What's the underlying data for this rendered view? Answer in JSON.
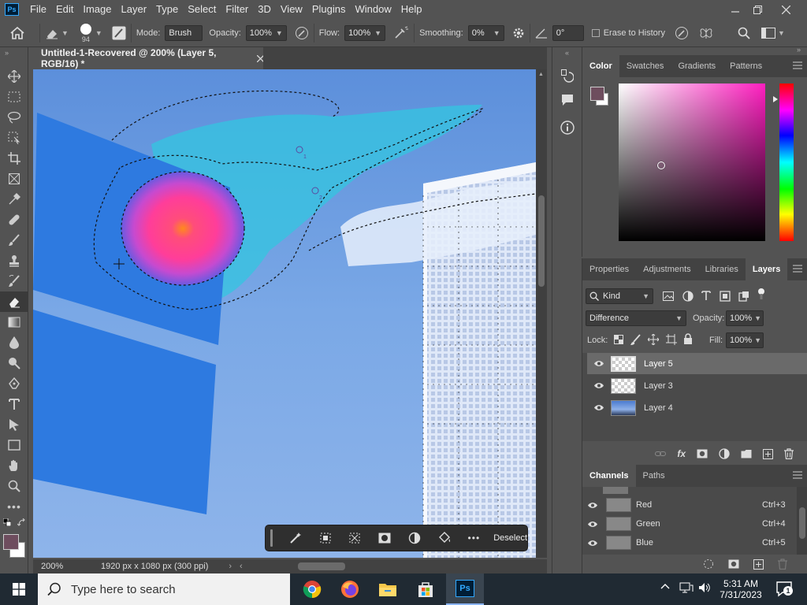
{
  "menu": {
    "app_logo": "Ps",
    "items": [
      "File",
      "Edit",
      "Image",
      "Layer",
      "Type",
      "Select",
      "Filter",
      "3D",
      "View",
      "Plugins",
      "Window",
      "Help"
    ]
  },
  "options_bar": {
    "brush_size": "94",
    "mode_label": "Mode:",
    "mode_value": "Brush",
    "opacity_label": "Opacity:",
    "opacity_value": "100%",
    "flow_label": "Flow:",
    "flow_value": "100%",
    "smoothing_label": "Smoothing:",
    "smoothing_value": "0%",
    "angle_value": "0°",
    "erase_history_label": "Erase to History"
  },
  "document": {
    "tab_title": "Untitled-1-Recovered @ 200% (Layer 5, RGB/16) *",
    "zoom": "200%",
    "dimensions": "1920 px x 1080 px (300 ppi)"
  },
  "contextual_bar": {
    "deselect_label": "Deselect"
  },
  "color_panel": {
    "tabs": [
      "Color",
      "Swatches",
      "Gradients",
      "Patterns"
    ],
    "active_tab": "Color",
    "foreground_color": "#6e4d5e",
    "background_color": "#ffffff"
  },
  "layers_panel": {
    "tabs": [
      "Properties",
      "Adjustments",
      "Libraries",
      "Layers"
    ],
    "active_tab": "Layers",
    "filter_kind": "Kind",
    "blend_mode": "Difference",
    "opacity_label": "Opacity:",
    "opacity_value": "100%",
    "lock_label": "Lock:",
    "fill_label": "Fill:",
    "fill_value": "100%",
    "layers": [
      {
        "name": "Layer 5",
        "selected": true
      },
      {
        "name": "Layer 3",
        "selected": false
      },
      {
        "name": "Layer 4",
        "selected": false
      }
    ]
  },
  "channels_panel": {
    "tabs": [
      "Channels",
      "Paths"
    ],
    "active_tab": "Channels",
    "channels": [
      {
        "name": "Red",
        "shortcut": "Ctrl+3"
      },
      {
        "name": "Green",
        "shortcut": "Ctrl+4"
      },
      {
        "name": "Blue",
        "shortcut": "Ctrl+5"
      }
    ]
  },
  "windows_taskbar": {
    "search_placeholder": "Type here to search",
    "time": "5:31 AM",
    "date": "7/31/2023",
    "notification_count": "1"
  },
  "colors": {
    "panel_bg": "#535353",
    "panel_dark": "#424242",
    "accent_blue": "#31a8ff",
    "sky_blue": "#6f9fe0"
  }
}
